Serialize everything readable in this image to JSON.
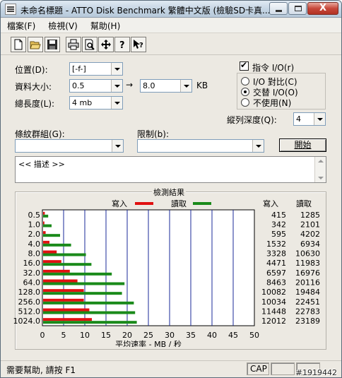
{
  "window": {
    "title": "未命名標題 - ATTO Disk Benchmark  繁體中文版 (檢驗SD卡真...",
    "close_glyph": "X"
  },
  "menu": [
    "檔案(F)",
    "檢視(V)",
    "幫助(H)"
  ],
  "toolbar_icons": [
    "new-icon",
    "open-icon",
    "save-icon",
    "print-icon",
    "print-preview-icon",
    "move-icon",
    "help-icon",
    "context-help-icon"
  ],
  "form": {
    "drive_label": "位置(D):",
    "drive_value": "[-f-]",
    "size_label": "資料大小:",
    "size_from": "0.5",
    "arrow": "→",
    "size_to": "8.0",
    "size_unit": "KB",
    "length_label": "總長度(L):",
    "length_value": "4 mb",
    "direct_io_label": "指令 I/O(r)",
    "direct_io_checked": true,
    "io_compare_label": "I/O 對比(C)",
    "overlapped_io_label": "交替 I/O(O)",
    "neither_label": "不使用(N)",
    "selected_io": "overlapped",
    "queue_depth_label": "縱列深度(Q):",
    "queue_depth_value": "4",
    "stripe_group_label": "條紋群組(G):",
    "stripe_group_value": "",
    "restrict_label": "限制(b):",
    "restrict_value": "",
    "start_button": "開始",
    "description": "<< 描述 >>"
  },
  "results": {
    "title": "檢測結果",
    "write_legend": "寫入",
    "read_legend": "讀取",
    "write_header": "寫入",
    "read_header": "讀取",
    "write_color": "#e01010",
    "read_color": "#1a8a1a"
  },
  "chart_data": {
    "type": "bar",
    "orientation": "horizontal",
    "categories": [
      "0.5",
      "1.0",
      "2.0",
      "4.0",
      "8.0",
      "16.0",
      "32.0",
      "64.0",
      "128.0",
      "256.0",
      "512.0",
      "1024.0"
    ],
    "series": [
      {
        "name": "寫入",
        "values": [
          0.4,
          0.3,
          0.6,
          1.5,
          3.2,
          4.3,
          6.3,
          8.1,
          9.6,
          9.6,
          10.9,
          11.5
        ],
        "labels": [
          "415",
          "342",
          "595",
          "1532",
          "3328",
          "4471",
          "6597",
          "8463",
          "10082",
          "10034",
          "11448",
          "12012"
        ]
      },
      {
        "name": "讀取",
        "values": [
          1.2,
          2.0,
          4.0,
          6.6,
          10.1,
          11.4,
          16.2,
          19.2,
          18.6,
          21.4,
          21.7,
          22.1
        ],
        "labels": [
          "1285",
          "2101",
          "4202",
          "6934",
          "10630",
          "11983",
          "16976",
          "20116",
          "19484",
          "22451",
          "22783",
          "23189"
        ]
      }
    ],
    "xlabel": "平均速率 - MB / 秒",
    "xlim": [
      0,
      50
    ],
    "xticks": [
      "0",
      "5",
      "10",
      "15",
      "20",
      "25",
      "30",
      "35",
      "40",
      "45",
      "50"
    ],
    "grid": true
  },
  "status": {
    "help_text": "需要幫助, 請按 F1",
    "cap": "CAP",
    "watermark": "#1919442"
  }
}
